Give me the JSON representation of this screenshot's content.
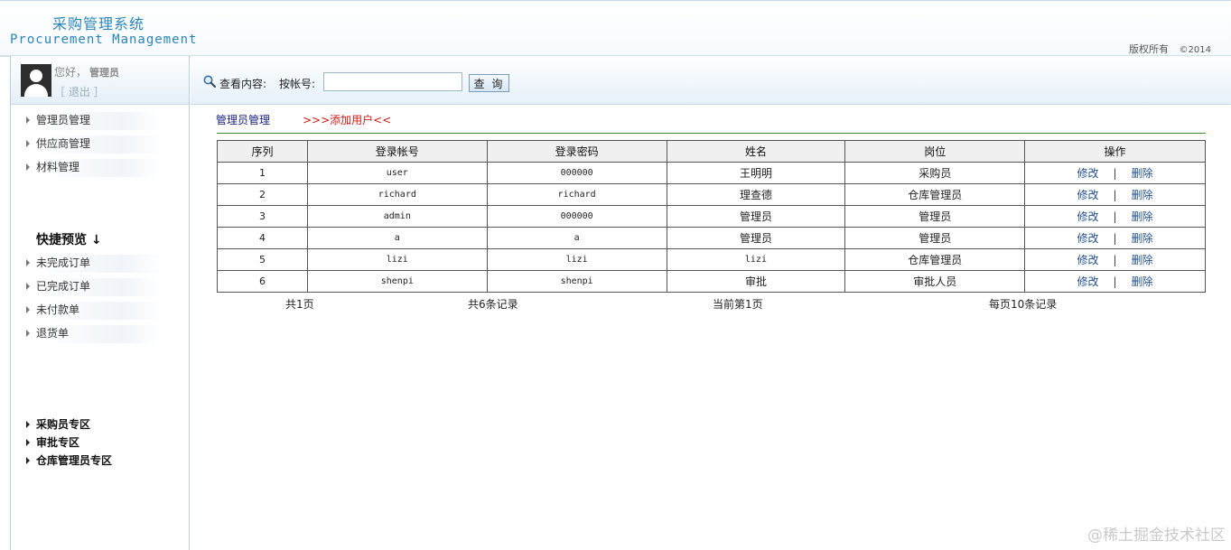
{
  "header": {
    "logo_cn": "采购管理系统",
    "logo_en": "Procurement Management",
    "copyright": "版权所有",
    "year": "©2014"
  },
  "sidebar": {
    "greeting": "您好，",
    "role": "管理员",
    "logout": "［ 退出 ］",
    "menu": [
      {
        "label": "管理员管理"
      },
      {
        "label": "供应商管理"
      },
      {
        "label": "材料管理"
      }
    ],
    "quick_title": "快捷预览 ↓",
    "quick": [
      {
        "label": "未完成订单"
      },
      {
        "label": "已完成订单"
      },
      {
        "label": "未付款单"
      },
      {
        "label": "退货单"
      }
    ],
    "zones": [
      {
        "label": "采购员专区"
      },
      {
        "label": "审批专区"
      },
      {
        "label": "仓库管理员专区"
      }
    ]
  },
  "search": {
    "label": "查看内容:",
    "by_label": "按帐号:",
    "value": "",
    "button": "查 询"
  },
  "main": {
    "breadcrumb": "管理员管理",
    "add_user": ">>>添加用户<<",
    "columns": [
      "序列",
      "登录帐号",
      "登录密码",
      "姓名",
      "岗位",
      "操作"
    ],
    "rows": [
      {
        "id": "1",
        "account": "user",
        "password": "000000",
        "name": "王明明",
        "position": "采购员"
      },
      {
        "id": "2",
        "account": "richard",
        "password": "richard",
        "name": "理查德",
        "position": "仓库管理员"
      },
      {
        "id": "3",
        "account": "admin",
        "password": "000000",
        "name": "管理员",
        "position": "管理员"
      },
      {
        "id": "4",
        "account": "a",
        "password": "a",
        "name": "管理员",
        "position": "管理员"
      },
      {
        "id": "5",
        "account": "lizi",
        "password": "lizi",
        "name": "lizi",
        "position": "仓库管理员"
      },
      {
        "id": "6",
        "account": "shenpi",
        "password": "shenpi",
        "name": "审批",
        "position": "审批人员"
      }
    ],
    "edit_label": "修改",
    "separator": "|",
    "delete_label": "删除",
    "pager": {
      "total_pages": "共1页",
      "total_records": "共6条记录",
      "current_page": "当前第1页",
      "per_page": "每页10条记录"
    }
  },
  "watermark": "@稀土掘金技术社区"
}
